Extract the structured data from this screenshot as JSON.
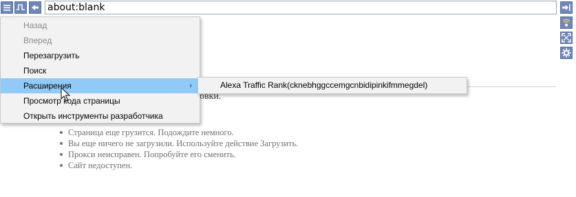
{
  "toolbar": {
    "address_value": "about:blank",
    "left_buttons": [
      {
        "icon": "menu-icon"
      },
      {
        "icon": "pulse-icon"
      },
      {
        "icon": "back-arrow-icon"
      }
    ],
    "right_buttons": [
      {
        "icon": "login-icon"
      },
      {
        "icon": "wifi-icon"
      },
      {
        "icon": "fullscreen-icon"
      },
      {
        "icon": "gear-icon"
      }
    ]
  },
  "page": {
    "heading_fragment": "ровки.",
    "reasons": [
      "Страница еще грузится. Подождите немного.",
      "Вы еще ничего не загрузили. Используйте действие Загрузить.",
      "Прокси неисправен. Попробуйте его сменить.",
      "Сайт недоступен."
    ]
  },
  "context_menu": {
    "items": [
      {
        "label": "Назад",
        "disabled": true
      },
      {
        "label": "Вперед",
        "disabled": true
      },
      {
        "label": "Перезагрузить",
        "disabled": false
      },
      {
        "label": "Поиск",
        "disabled": false
      },
      {
        "label": "Расширения",
        "disabled": false,
        "highlighted": true,
        "submenu_arrow": "›"
      },
      {
        "label": "Просмотр кода страницы",
        "disabled": false
      },
      {
        "label": "Открыть инструменты разработчика",
        "disabled": false
      }
    ],
    "submenu": {
      "items": [
        "Alexa Traffic Rank(cknebhggccemgcnbidipinkifmmegdel)"
      ]
    }
  },
  "colors": {
    "button_blue": "#6f87b8",
    "menu_highlight": "#91c9f7",
    "menu_background": "#f2f2f2",
    "disabled_text": "#8a8a8a"
  }
}
